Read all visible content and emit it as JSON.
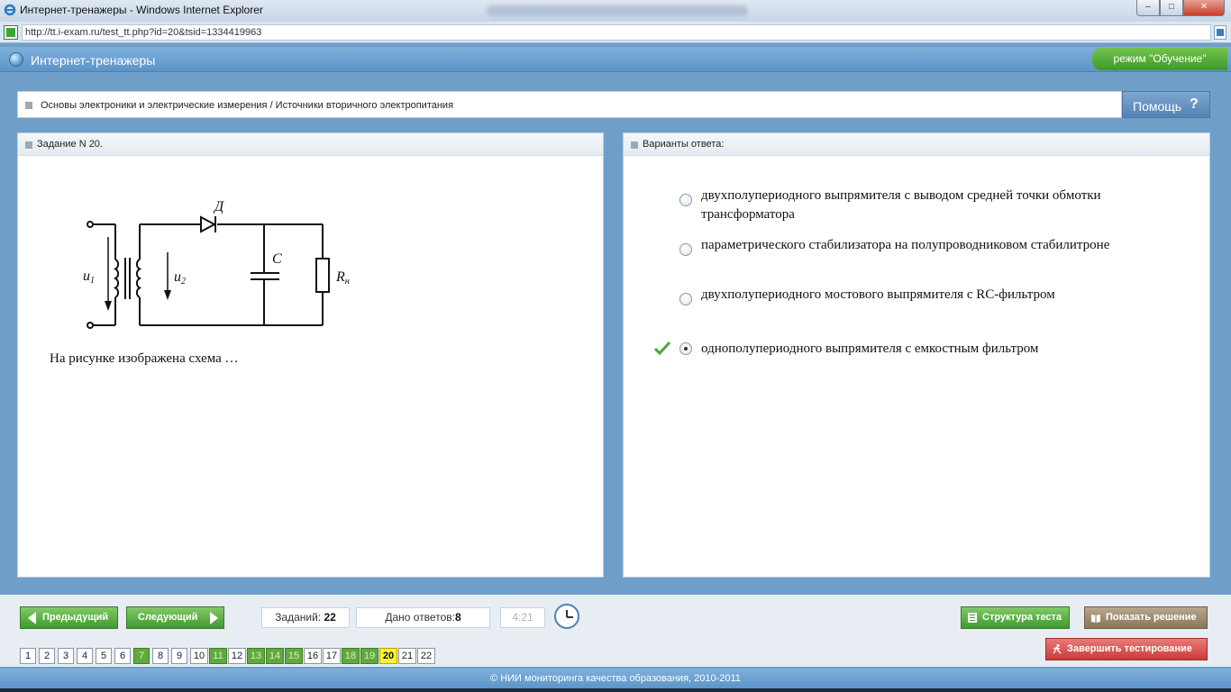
{
  "window": {
    "title": "Интернет-тренажеры - Windows Internet Explorer",
    "url": "http://tt.i-exam.ru/test_tt.php?id=20&tsid=1334419963",
    "controls": {
      "minimize": "–",
      "maximize": "□",
      "close": "✕"
    }
  },
  "app": {
    "title": "Интернет-тренажеры",
    "mode": "режим \"Обучение\""
  },
  "breadcrumb": "Основы электроники и электрические измерения / Источники вторичного электропитания",
  "help": {
    "label": "Помощь",
    "icon": "?"
  },
  "task": {
    "header": "Задание N 20.",
    "question": "На рисунке изображена схема …",
    "circuit_labels": {
      "u1": "u",
      "u1_sub": "1",
      "u2": "u",
      "u2_sub": "2",
      "diode": "Д",
      "capacitor": "C",
      "resistor": "R",
      "resistor_sub": "н"
    }
  },
  "answers": {
    "header": "Варианты ответа:",
    "options": [
      {
        "text": "двухполупериодного выпрямителя с выводом средней точки обмотки трансформатора",
        "selected": false,
        "correct": false
      },
      {
        "text": "параметрического стабилизатора на полупроводниковом стабилитроне",
        "selected": false,
        "correct": false
      },
      {
        "text": "двухполупериодного мостового выпрямителя с RC-фильтром",
        "selected": false,
        "correct": false
      },
      {
        "text": "однополупериодного выпрямителя с емкостным фильтром",
        "selected": true,
        "correct": true
      }
    ]
  },
  "navigation": {
    "prev": "Предыдущий",
    "next": "Следующий",
    "tasks_label": "Заданий:",
    "tasks_count": "22",
    "answers_label": "Дано ответов:",
    "answers_count": "8",
    "timer": "4:21",
    "structure": "Структура теста",
    "show_solution": "Показать решение",
    "finish": "Завершить тестирование"
  },
  "pages": [
    {
      "n": "1",
      "state": "plain"
    },
    {
      "n": "2",
      "state": "plain"
    },
    {
      "n": "3",
      "state": "plain"
    },
    {
      "n": "4",
      "state": "plain"
    },
    {
      "n": "5",
      "state": "plain"
    },
    {
      "n": "6",
      "state": "plain"
    },
    {
      "n": "7",
      "state": "answered"
    },
    {
      "n": "8",
      "state": "plain"
    },
    {
      "n": "9",
      "state": "plain"
    },
    {
      "n": "10",
      "state": "plain"
    },
    {
      "n": "11",
      "state": "answered"
    },
    {
      "n": "12",
      "state": "plain"
    },
    {
      "n": "13",
      "state": "answered"
    },
    {
      "n": "14",
      "state": "answered"
    },
    {
      "n": "15",
      "state": "answered"
    },
    {
      "n": "16",
      "state": "plain"
    },
    {
      "n": "17",
      "state": "plain"
    },
    {
      "n": "18",
      "state": "answered"
    },
    {
      "n": "19",
      "state": "answered"
    },
    {
      "n": "20",
      "state": "current"
    },
    {
      "n": "21",
      "state": "plain"
    },
    {
      "n": "22",
      "state": "plain"
    }
  ],
  "footer": "© НИИ мониторинга качества образования, 2010-2011",
  "colors": {
    "accent_blue": "#5d95c9",
    "answered_green": "#62a83e",
    "current_yellow": "#ffef3a",
    "finish_red": "#c93c39"
  }
}
